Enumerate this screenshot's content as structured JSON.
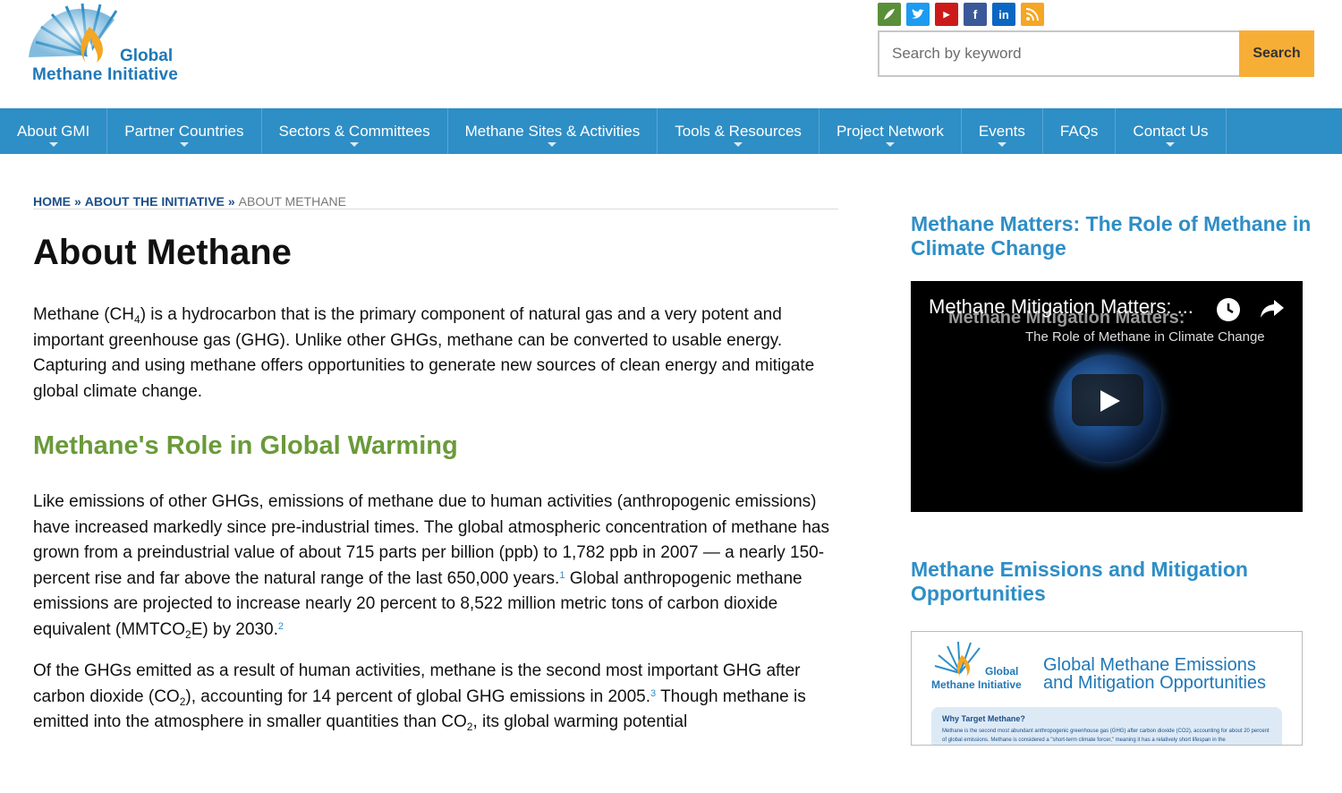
{
  "header": {
    "logo": {
      "line1": "Global",
      "line2": "Methane Initiative"
    },
    "social": [
      {
        "icon": "globalmethane-icon",
        "color": "#5a8f3a",
        "glyph": ""
      },
      {
        "icon": "twitter-icon",
        "color": "#1d9bf0",
        "glyph": "t"
      },
      {
        "icon": "youtube-icon",
        "color": "#cc1a1a",
        "glyph": "You"
      },
      {
        "icon": "facebook-icon",
        "color": "#3b5998",
        "glyph": "f"
      },
      {
        "icon": "linkedin-icon",
        "color": "#0a66c2",
        "glyph": "in"
      },
      {
        "icon": "rss-icon",
        "color": "#f5a623",
        "glyph": ""
      }
    ],
    "search": {
      "placeholder": "Search by keyword",
      "button": "Search"
    }
  },
  "nav": {
    "items": [
      {
        "label": "About GMI",
        "caret": true
      },
      {
        "label": "Partner Countries",
        "caret": true
      },
      {
        "label": "Sectors & Committees",
        "caret": true
      },
      {
        "label": "Methane Sites & Activities",
        "caret": true
      },
      {
        "label": "Tools & Resources",
        "caret": true
      },
      {
        "label": "Project Network",
        "caret": true
      },
      {
        "label": "Events",
        "caret": true
      },
      {
        "label": "FAQs",
        "caret": false
      },
      {
        "label": "Contact Us",
        "caret": true
      }
    ]
  },
  "breadcrumb": {
    "home": "HOME",
    "sep": "»",
    "parent": "ABOUT THE INITIATIVE",
    "current": "ABOUT METHANE"
  },
  "main": {
    "title": "About Methane",
    "p1": {
      "a": "Methane (CH",
      "a_sub": "4",
      "b": ") is a hydrocarbon that is the primary component of natural gas and a very potent and important greenhouse gas (GHG). Unlike other GHGs, methane can be converted to usable energy. Capturing and using methane offers opportunities to generate new sources of clean energy and mitigate global climate change."
    },
    "heading": "Methane's Role in Global Warming",
    "p2": {
      "a": "Like emissions of other GHGs, emissions of methane due to human activities (anthropogenic emissions) have increased markedly since pre-industrial times. The global atmospheric concentration of methane has grown from a preindustrial value of about 715 parts per billion (ppb) to 1,782 ppb in 2007 — a nearly 150-percent rise and far above the natural range of the last 650,000 years.",
      "fn1": "1",
      "b": " Global anthropogenic methane emissions are projected to increase nearly 20 percent to 8,522 million metric tons of carbon dioxide equivalent (MMTCO",
      "b_sub": "2",
      "c": "E) by 2030.",
      "fn2": "2"
    },
    "p3": {
      "a": "Of the GHGs emitted as a result of human activities, methane is the second most important GHG after carbon dioxide (CO",
      "a_sub": "2",
      "b": "), accounting for 14 percent of global GHG emissions in 2005.",
      "fn3": "3",
      "c": " Though methane is emitted into the atmosphere in smaller quantities than CO",
      "c_sub": "2",
      "d": ", its global warming potential"
    }
  },
  "sidebar": {
    "video_heading": "Methane Matters: The Role of Methane in Climate Change",
    "video": {
      "title": "Methane Mitigation Matters: ...",
      "ghost_title": "Methane Mitigation Matters:",
      "subtitle": "The Role of Methane in Climate Change"
    },
    "poster_heading": "Methane Emissions and Mitigation Opportunities",
    "poster": {
      "logo1": "Global",
      "logo2": "Methane Initiative",
      "title1": "Global Methane Emissions",
      "title2": "and Mitigation Opportunities",
      "box_heading": "Why Target Methane?",
      "box_text": "Methane is the second most abundant anthropogenic greenhouse gas (GHG) after carbon dioxide (CO2), accounting for about 20 percent of global emissions. Methane is considered a \"short-term climate forcer,\" meaning it has a relatively short lifespan in the"
    }
  },
  "colors": {
    "nav": "#2e8ec6",
    "accent_blue": "#2e8ec6",
    "heading_green": "#6a9a3a",
    "search_button": "#f7ae37",
    "breadcrumb": "#1c4f8a"
  }
}
